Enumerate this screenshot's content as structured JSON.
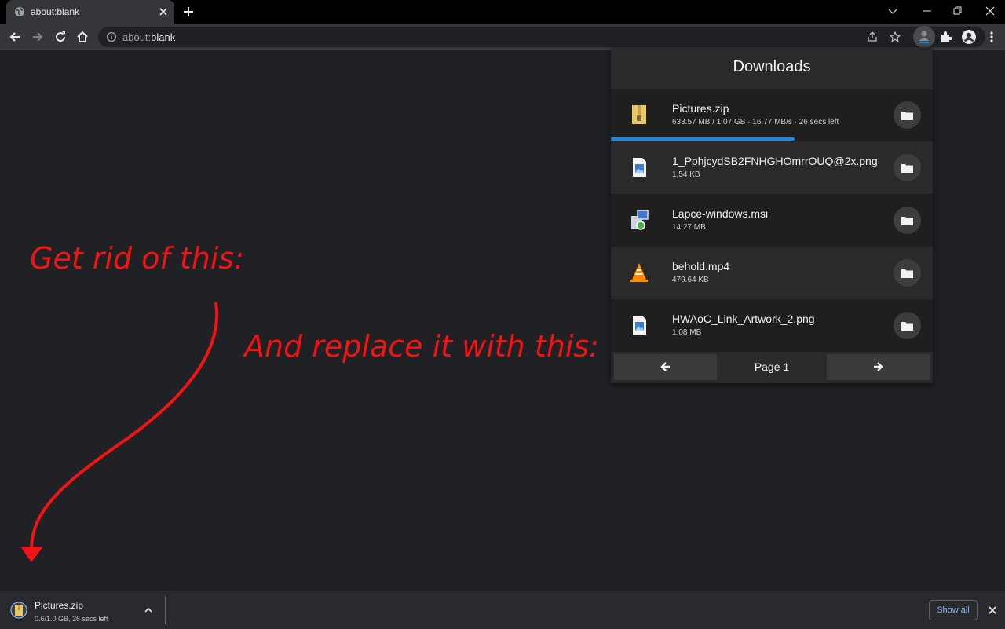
{
  "tab": {
    "title": "about:blank"
  },
  "omnibox": {
    "url_scheme": "about:",
    "url_path": "blank"
  },
  "annotations": {
    "first": "Get rid of this:",
    "second": "And replace it with this:",
    "color": "#f01414"
  },
  "downloads_panel": {
    "title": "Downloads",
    "items": [
      {
        "name": "Pictures.zip",
        "meta": "633.57 MB / 1.07 GB  ·  16.77 MB/s  ·  26 secs left",
        "icon": "zip-archive-icon",
        "progress": 0.58
      },
      {
        "name": "1_PphjcydSB2FNHGHOmrrOUQ@2x.png",
        "meta": "1.54 KB",
        "icon": "image-file-icon"
      },
      {
        "name": "Lapce-windows.msi",
        "meta": "14.27 MB",
        "icon": "installer-icon"
      },
      {
        "name": "behold.mp4",
        "meta": "479.64 KB",
        "icon": "vlc-cone-icon"
      },
      {
        "name": "HWAoC_Link_Artwork_2.png",
        "meta": "1.08 MB",
        "icon": "image-file-icon"
      }
    ],
    "pager": {
      "label": "Page 1",
      "prev": "arrow-left-icon",
      "next": "arrow-right-icon"
    },
    "accent": "#1e88e5"
  },
  "shelf": {
    "item_name": "Pictures.zip",
    "item_meta": "0.6/1.0 GB, 26 secs left",
    "show_all": "Show all"
  }
}
